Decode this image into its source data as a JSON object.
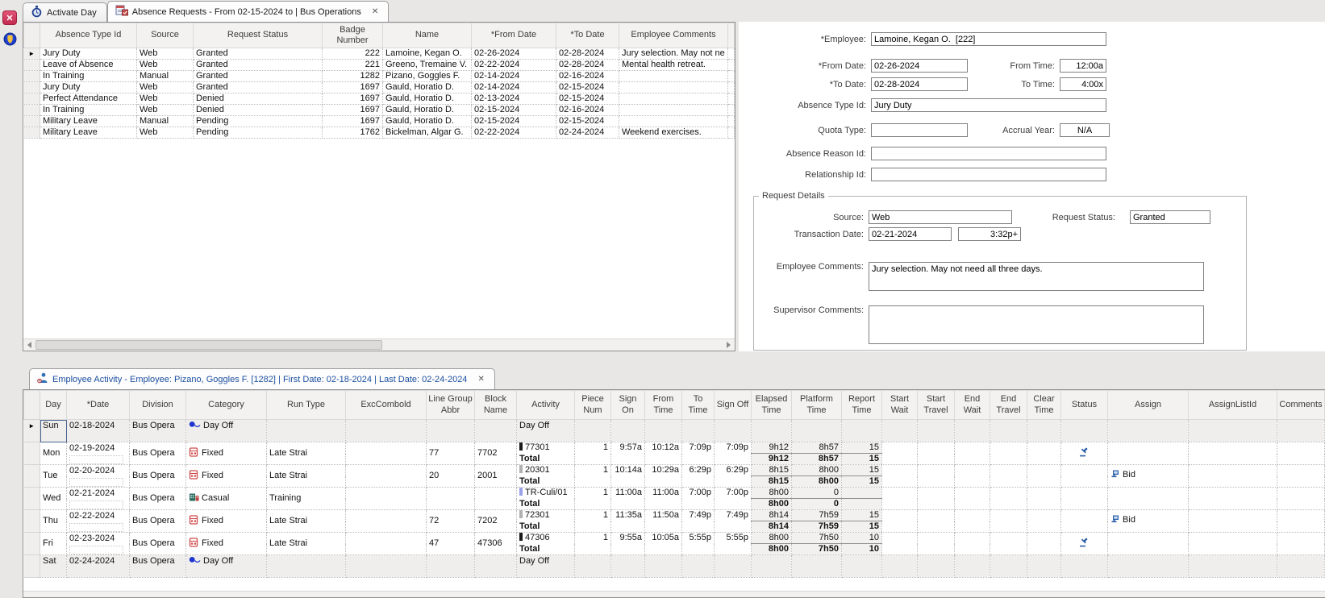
{
  "colors": {
    "accent_blue": "#1b4fa0",
    "close_red": "#c22a4e",
    "icon_blue": "#2b5fa8"
  },
  "left_toolbar": {
    "close_glyph": "✕"
  },
  "top_tabs": {
    "activate_day": "Activate Day",
    "absence_requests": "Absence Requests - From 02-15-2024 to  | Bus Operations",
    "close_glyph": "✕"
  },
  "absence_table": {
    "headers": [
      "Absence Type Id",
      "Source",
      "Request Status",
      "Badge Number",
      "Name",
      "*From Date",
      "*To Date",
      "Employee Comments"
    ],
    "rows": [
      {
        "type": "Jury Duty",
        "source": "Web",
        "status": "Granted",
        "badge": "222",
        "name": "Lamoine, Kegan O.",
        "from_date": "02-26-2024",
        "to_date": "02-28-2024",
        "comments": "Jury selection. May not ne"
      },
      {
        "type": "Leave of Absence",
        "source": "Web",
        "status": "Granted",
        "badge": "221",
        "name": "Greeno, Tremaine V.",
        "from_date": "02-22-2024",
        "to_date": "02-28-2024",
        "comments": "Mental health retreat."
      },
      {
        "type": "In Training",
        "source": "Manual",
        "status": "Granted",
        "badge": "1282",
        "name": "Pizano, Goggles F.",
        "from_date": "02-14-2024",
        "to_date": "02-16-2024",
        "comments": ""
      },
      {
        "type": "Jury Duty",
        "source": "Web",
        "status": "Granted",
        "badge": "1697",
        "name": "Gauld, Horatio D.",
        "from_date": "02-14-2024",
        "to_date": "02-15-2024",
        "comments": ""
      },
      {
        "type": "Perfect Attendance",
        "source": "Web",
        "status": "Denied",
        "badge": "1697",
        "name": "Gauld, Horatio D.",
        "from_date": "02-13-2024",
        "to_date": "02-15-2024",
        "comments": ""
      },
      {
        "type": "In Training",
        "source": "Web",
        "status": "Denied",
        "badge": "1697",
        "name": "Gauld, Horatio D.",
        "from_date": "02-15-2024",
        "to_date": "02-16-2024",
        "comments": ""
      },
      {
        "type": "Military Leave",
        "source": "Manual",
        "status": "Pending",
        "badge": "1697",
        "name": "Gauld, Horatio D.",
        "from_date": "02-15-2024",
        "to_date": "02-15-2024",
        "comments": ""
      },
      {
        "type": "Military Leave",
        "source": "Web",
        "status": "Pending",
        "badge": "1762",
        "name": "Bickelman, Algar G.",
        "from_date": "02-22-2024",
        "to_date": "02-24-2024",
        "comments": "Weekend exercises."
      }
    ]
  },
  "form": {
    "employee_label": "*Employee:",
    "employee_value": "Lamoine, Kegan O.  [222]",
    "from_date_label": "*From Date:",
    "from_date_value": "02-26-2024",
    "from_time_label": "From Time:",
    "from_time_value": "12:00a",
    "to_date_label": "*To Date:",
    "to_date_value": "02-28-2024",
    "to_time_label": "To Time:",
    "to_time_value": "4:00x",
    "absence_type_label": "Absence Type Id:",
    "absence_type_value": "Jury Duty",
    "quota_type_label": "Quota Type:",
    "quota_type_value": "",
    "accrual_year_label": "Accrual Year:",
    "accrual_year_value": "N/A",
    "absence_reason_label": "Absence Reason Id:",
    "absence_reason_value": "",
    "relationship_label": "Relationship Id:",
    "relationship_value": "",
    "request_details": {
      "title": "Request Details",
      "source_label": "Source:",
      "source_value": "Web",
      "request_status_label": "Request Status:",
      "request_status_value": "Granted",
      "transaction_date_label": "Transaction Date:",
      "transaction_date_value": "02-21-2024",
      "transaction_time_value": "3:32p+",
      "employee_comments_label": "Employee Comments:",
      "employee_comments_value": "Jury selection. May not need all three days.",
      "supervisor_comments_label": "Supervisor Comments:",
      "supervisor_comments_value": ""
    }
  },
  "bottom_tab": {
    "label": "Employee Activity - Employee: Pizano, Goggles F. [1282]  | First Date: 02-18-2024 | Last Date: 02-24-2024",
    "close_glyph": "✕"
  },
  "activity_table": {
    "headers": [
      "Day",
      "*Date",
      "Division",
      "Category",
      "Run Type",
      "ExcCombold",
      "Line Group Abbr",
      "Block Name",
      "Activity",
      "Piece Num",
      "Sign On",
      "From Time",
      "To Time",
      "Sign Off",
      "Elapsed Time",
      "Platform Time",
      "Report Time",
      "Start Wait",
      "Start Travel",
      "End Wait",
      "End Travel",
      "Clear Time",
      "Status",
      "Assign",
      "AssignListId",
      "Comments"
    ],
    "rows": [
      {
        "day": "Sun",
        "date": "02-18-2024",
        "division": "Bus Opera",
        "category": "Day Off",
        "category_icon": "dayoff-icon",
        "activity": "Day Off",
        "day_off": true,
        "selected": true
      },
      {
        "day": "Mon",
        "date": "02-19-2024",
        "division": "Bus Opera",
        "category": "Fixed",
        "category_icon": "bus-icon",
        "run_type": "Late Strai",
        "line_group": "77",
        "block": "7702",
        "activity": "77301",
        "bar": "#1a1a1a",
        "piece": "1",
        "sign_on": "9:57a",
        "from_time": "10:12a",
        "to_time": "7:09p",
        "sign_off": "7:09p",
        "elapsed": "9h12",
        "platform": "8h57",
        "report": "15",
        "total_label": "Total",
        "total_elapsed": "9h12",
        "total_platform": "8h57",
        "total_report": "15",
        "status_icon": "gavel-icon"
      },
      {
        "day": "Tue",
        "date": "02-20-2024",
        "division": "Bus Opera",
        "category": "Fixed",
        "category_icon": "bus-icon",
        "run_type": "Late Strai",
        "line_group": "20",
        "block": "2001",
        "activity": "20301",
        "bar": "#b0b0b0",
        "piece": "1",
        "sign_on": "10:14a",
        "from_time": "10:29a",
        "to_time": "6:29p",
        "sign_off": "6:29p",
        "elapsed": "8h15",
        "platform": "8h00",
        "report": "15",
        "total_label": "Total",
        "total_elapsed": "8h15",
        "total_platform": "8h00",
        "total_report": "15",
        "assign": "Bid",
        "assign_icon": "bid-icon"
      },
      {
        "day": "Wed",
        "date": "02-21-2024",
        "division": "Bus Opera",
        "category": "Casual",
        "category_icon": "casual-icon",
        "run_type": "Training",
        "line_group": "",
        "block": "",
        "activity": "TR-Culi/01",
        "bar": "#9aa2e6",
        "piece": "1",
        "sign_on": "11:00a",
        "from_time": "11:00a",
        "to_time": "7:00p",
        "sign_off": "7:00p",
        "elapsed": "8h00",
        "platform": "0",
        "report": "",
        "total_label": "Total",
        "total_elapsed": "8h00",
        "total_platform": "0",
        "total_report": ""
      },
      {
        "day": "Thu",
        "date": "02-22-2024",
        "division": "Bus Opera",
        "category": "Fixed",
        "category_icon": "bus-icon",
        "run_type": "Late Strai",
        "line_group": "72",
        "block": "7202",
        "activity": "72301",
        "bar": "#b0b0b0",
        "piece": "1",
        "sign_on": "11:35a",
        "from_time": "11:50a",
        "to_time": "7:49p",
        "sign_off": "7:49p",
        "elapsed": "8h14",
        "platform": "7h59",
        "report": "15",
        "total_label": "Total",
        "total_elapsed": "8h14",
        "total_platform": "7h59",
        "total_report": "15",
        "assign": "Bid",
        "assign_icon": "bid-icon"
      },
      {
        "day": "Fri",
        "date": "02-23-2024",
        "division": "Bus Opera",
        "category": "Fixed",
        "category_icon": "bus-icon",
        "run_type": "Late Strai",
        "line_group": "47",
        "block": "47306",
        "activity": "47306",
        "bar": "#1a1a1a",
        "piece": "1",
        "sign_on": "9:55a",
        "from_time": "10:05a",
        "to_time": "5:55p",
        "sign_off": "5:55p",
        "elapsed": "8h00",
        "platform": "7h50",
        "report": "10",
        "total_label": "Total",
        "total_elapsed": "8h00",
        "total_platform": "7h50",
        "total_report": "10",
        "status_icon": "gavel-icon"
      },
      {
        "day": "Sat",
        "date": "02-24-2024",
        "division": "Bus Opera",
        "category": "Day Off",
        "category_icon": "dayoff-icon",
        "activity": "Day Off",
        "day_off": true
      }
    ]
  }
}
